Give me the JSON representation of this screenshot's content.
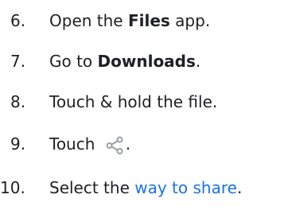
{
  "steps": [
    {
      "number": "6.",
      "pre": "Open the ",
      "bold": "Files",
      "post": " app."
    },
    {
      "number": "7.",
      "pre": "Go to ",
      "bold": "Downloads",
      "post": "."
    },
    {
      "number": "8.",
      "text": "Touch & hold the file."
    },
    {
      "number": "9.",
      "pre": "Touch ",
      "icon": "share-icon",
      "post": "."
    },
    {
      "number": "10.",
      "pre": "Select the ",
      "link": "way to share",
      "post": "."
    }
  ],
  "colors": {
    "text": "#202124",
    "link": "#1a73e8",
    "icon": "#9aa0a6"
  }
}
